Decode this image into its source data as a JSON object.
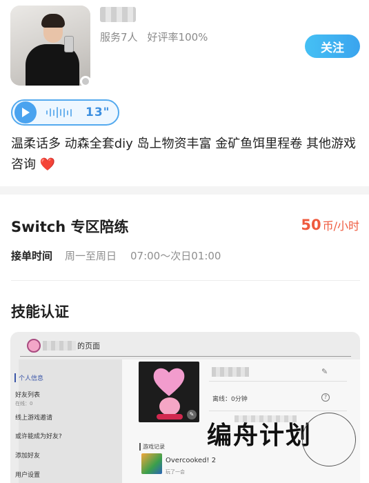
{
  "profile": {
    "stats": [
      "服务7人",
      "好评率100%"
    ],
    "follow_label": "关注",
    "voice_duration": "13\"",
    "bio": "温柔话多 动森全套diy 岛上物资丰富 金矿鱼饵里程卷 其他游戏咨询",
    "bio_emoji": "❤️"
  },
  "service": {
    "title": "Switch 专区陪练",
    "price_value": "50",
    "price_unit": "币/小时",
    "time_label": "接单时间",
    "days": "周一至周日",
    "hours": "07:00～次日01:00"
  },
  "skill": {
    "title": "技能认证",
    "screenshot": {
      "header_suffix": "的页面",
      "nav": [
        {
          "label": "个人信息",
          "sub": ""
        },
        {
          "label": "好友列表",
          "sub": "在线：0"
        },
        {
          "label": "线上游戏邀请",
          "sub": ""
        },
        {
          "label": "或许能成为好友?",
          "sub": ""
        },
        {
          "label": "添加好友",
          "sub": ""
        },
        {
          "label": "用户设置",
          "sub": ""
        }
      ],
      "offline_text": "离线：0分钟",
      "records_title": "游戏记录",
      "game_name": "Overcooked! 2",
      "game_sub": "玩了一会"
    }
  },
  "watermark": "编舟计划",
  "colors": {
    "accent_blue": "#3aa4ee",
    "price_red": "#ef5a3e"
  }
}
